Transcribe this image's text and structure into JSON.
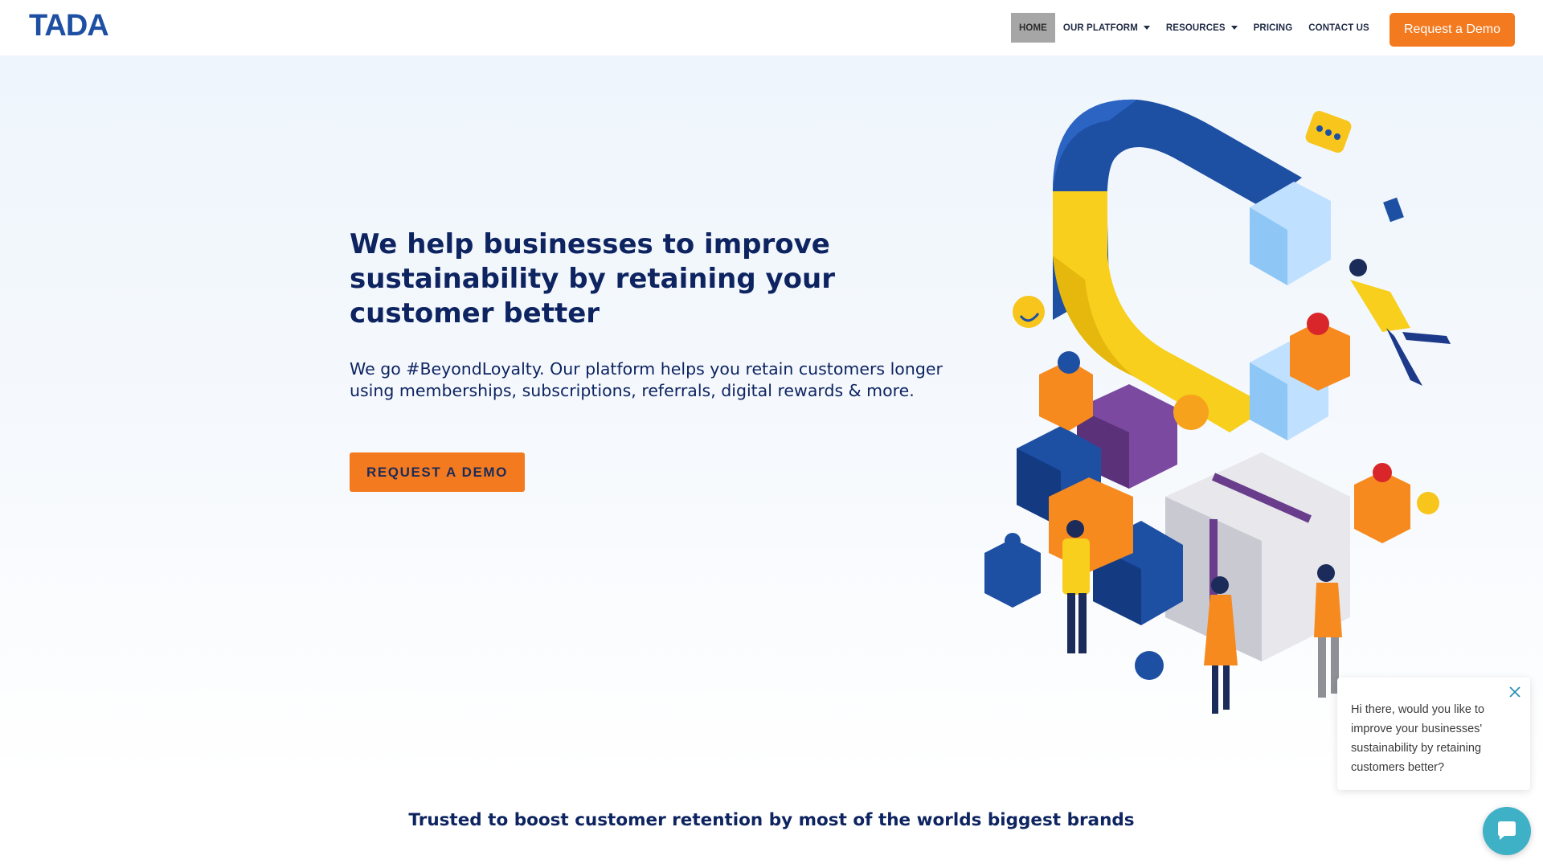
{
  "brand": {
    "name": "TADA",
    "color": "#1d4fa3"
  },
  "nav": {
    "items": [
      {
        "label": "HOME",
        "active": true,
        "dropdown": false
      },
      {
        "label": "OUR PLATFORM",
        "active": false,
        "dropdown": true
      },
      {
        "label": "RESOURCES",
        "active": false,
        "dropdown": true
      },
      {
        "label": "PRICING",
        "active": false,
        "dropdown": false
      },
      {
        "label": "CONTACT US",
        "active": false,
        "dropdown": false
      }
    ],
    "cta_label": "Request a Demo"
  },
  "hero": {
    "title": "We help businesses to improve sustainability by retaining your customer better",
    "subtitle": "We go #BeyondLoyalty. Our platform helps you retain customers longer using memberships, subscriptions, referrals, digital rewards & more.",
    "cta_label": "REQUEST A DEMO"
  },
  "trusted": {
    "heading": "Trusted to boost customer retention by most of the worlds biggest brands"
  },
  "chat": {
    "message": "Hi there, would you like to improve your businesses' sustainability by retaining customers better?",
    "close_icon": "close-icon",
    "launcher_icon": "chat-bubble-icon"
  },
  "colors": {
    "accent": "#f47a1f",
    "navy": "#0e2461",
    "chat": "#3fb1c6"
  }
}
